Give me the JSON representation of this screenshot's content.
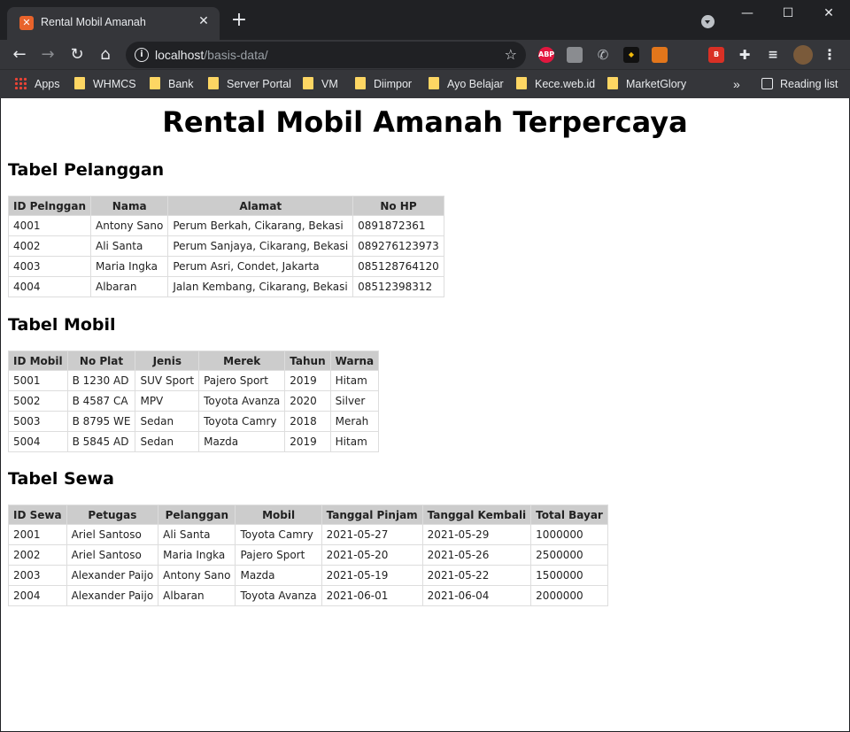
{
  "browser": {
    "tab_title": "Rental Mobil Amanah",
    "tab_favicon": "xampp-icon",
    "url_host": "localhost",
    "url_path": "/basis-data/",
    "bookmarks": [
      "Apps",
      "WHMCS",
      "Bank",
      "Server Portal",
      "VM",
      "Diimpor",
      "Ayo Belajar",
      "Kece.web.id",
      "MarketGlory"
    ],
    "more_bookmarks": "»",
    "reading_list": "Reading list"
  },
  "page": {
    "title": "Rental Mobil Amanah Terpercaya",
    "sections": [
      {
        "heading": "Tabel Pelanggan",
        "columns": [
          "ID Pelnggan",
          "Nama",
          "Alamat",
          "No HP"
        ],
        "rows": [
          [
            "4001",
            "Antony Sano",
            "Perum Berkah, Cikarang, Bekasi",
            "0891872361"
          ],
          [
            "4002",
            "Ali Santa",
            "Perum Sanjaya, Cikarang, Bekasi",
            "089276123973"
          ],
          [
            "4003",
            "Maria Ingka",
            "Perum Asri, Condet, Jakarta",
            "085128764120"
          ],
          [
            "4004",
            "Albaran",
            "Jalan Kembang, Cikarang, Bekasi",
            "08512398312"
          ]
        ]
      },
      {
        "heading": "Tabel Mobil",
        "columns": [
          "ID Mobil",
          "No Plat",
          "Jenis",
          "Merek",
          "Tahun",
          "Warna"
        ],
        "rows": [
          [
            "5001",
            "B 1230 AD",
            "SUV Sport",
            "Pajero Sport",
            "2019",
            "Hitam"
          ],
          [
            "5002",
            "B 4587 CA",
            "MPV",
            "Toyota Avanza",
            "2020",
            "Silver"
          ],
          [
            "5003",
            "B 8795 WE",
            "Sedan",
            "Toyota Camry",
            "2018",
            "Merah"
          ],
          [
            "5004",
            "B 5845 AD",
            "Sedan",
            "Mazda",
            "2019",
            "Hitam"
          ]
        ]
      },
      {
        "heading": "Tabel Sewa",
        "columns": [
          "ID Sewa",
          "Petugas",
          "Pelanggan",
          "Mobil",
          "Tanggal Pinjam",
          "Tanggal Kembali",
          "Total Bayar"
        ],
        "rows": [
          [
            "2001",
            "Ariel Santoso",
            "Ali Santa",
            "Toyota Camry",
            "2021-05-27",
            "2021-05-29",
            "1000000"
          ],
          [
            "2002",
            "Ariel Santoso",
            "Maria Ingka",
            "Pajero Sport",
            "2021-05-20",
            "2021-05-26",
            "2500000"
          ],
          [
            "2003",
            "Alexander Paijo",
            "Antony Sano",
            "Mazda",
            "2021-05-19",
            "2021-05-22",
            "1500000"
          ],
          [
            "2004",
            "Alexander Paijo",
            "Albaran",
            "Toyota Avanza",
            "2021-06-01",
            "2021-06-04",
            "2000000"
          ]
        ]
      }
    ]
  },
  "colors": {
    "chrome_dark": "#202124",
    "chrome_toolbar": "#35363a",
    "table_header_bg": "#cccccc",
    "table_border": "#dddddd"
  }
}
